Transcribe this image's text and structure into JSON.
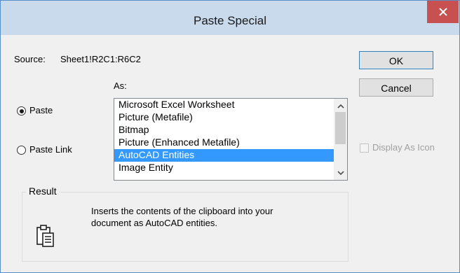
{
  "window": {
    "title": "Paste Special",
    "close_label": "×"
  },
  "source": {
    "label": "Source:",
    "value": "Sheet1!R2C1:R6C2"
  },
  "as_label": "As:",
  "paste_options": [
    {
      "label": "Paste",
      "checked": true
    },
    {
      "label": "Paste Link",
      "checked": false
    }
  ],
  "as_list": {
    "items": [
      "Microsoft Excel Worksheet",
      "Picture (Metafile)",
      "Bitmap",
      "Picture (Enhanced Metafile)",
      "AutoCAD Entities",
      "Image Entity"
    ],
    "selected": "AutoCAD Entities"
  },
  "buttons": {
    "ok": "OK",
    "cancel": "Cancel"
  },
  "display_as_icon": {
    "label": "Display As Icon",
    "checked": false,
    "enabled": false
  },
  "result": {
    "label": "Result",
    "line1": "Inserts the contents of the clipboard into your",
    "line2": "document as AutoCAD entities."
  },
  "colors": {
    "selection": "#3399ff",
    "close_button": "#c75050",
    "titlebar": "#c9daed"
  }
}
